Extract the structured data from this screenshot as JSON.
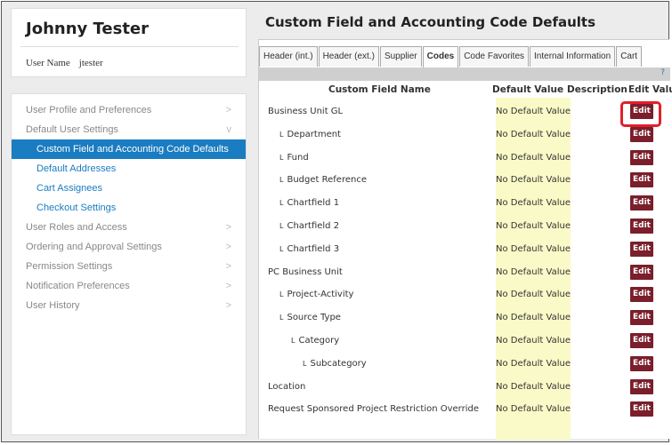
{
  "user": {
    "display_name": "Johnny Tester",
    "username_label": "User Name",
    "username_value": "jtester"
  },
  "nav": {
    "items": [
      {
        "label": "User Profile and Preferences",
        "chevron": ">"
      },
      {
        "label": "Default User Settings",
        "chevron": "v"
      },
      {
        "label": "Custom Field and Accounting Code Defaults"
      },
      {
        "label": "Default Addresses"
      },
      {
        "label": "Cart Assignees"
      },
      {
        "label": "Checkout Settings"
      },
      {
        "label": "User Roles and Access",
        "chevron": ">"
      },
      {
        "label": "Ordering and Approval Settings",
        "chevron": ">"
      },
      {
        "label": "Permission Settings",
        "chevron": ">"
      },
      {
        "label": "Notification Preferences",
        "chevron": ">"
      },
      {
        "label": "User History",
        "chevron": ">"
      }
    ]
  },
  "page": {
    "title": "Custom Field and Accounting Code Defaults",
    "help": "?"
  },
  "tabs": [
    "Header (int.)",
    "Header (ext.)",
    "Supplier",
    "Codes",
    "Code Favorites",
    "Internal Information",
    "Cart"
  ],
  "table": {
    "headers": {
      "name": "Custom Field Name",
      "default": "Default Value",
      "description": "Description",
      "edit": "Edit Values"
    },
    "rows": [
      {
        "name": "Business Unit GL",
        "value": "No Default Value",
        "edit": "Edit"
      },
      {
        "name": "Department",
        "prefix": "L",
        "value": "No Default Value",
        "edit": "Edit"
      },
      {
        "name": "Fund",
        "prefix": "L",
        "value": "No Default Value",
        "edit": "Edit"
      },
      {
        "name": "Budget Reference",
        "prefix": "L",
        "value": "No Default Value",
        "edit": "Edit"
      },
      {
        "name": "Chartfield 1",
        "prefix": "L",
        "value": "No Default Value",
        "edit": "Edit"
      },
      {
        "name": "Chartfield 2",
        "prefix": "L",
        "value": "No Default Value",
        "edit": "Edit"
      },
      {
        "name": "Chartfield 3",
        "prefix": "L",
        "value": "No Default Value",
        "edit": "Edit"
      },
      {
        "name": "PC Business Unit",
        "value": "No Default Value",
        "edit": "Edit"
      },
      {
        "name": "Project-Activity",
        "prefix": "L",
        "value": "No Default Value",
        "edit": "Edit"
      },
      {
        "name": "Source Type",
        "prefix": "L",
        "value": "No Default Value",
        "edit": "Edit"
      },
      {
        "name": "Category",
        "prefix": "L",
        "value": "No Default Value",
        "edit": "Edit"
      },
      {
        "name": "Subcategory",
        "prefix": "L",
        "value": "No Default Value",
        "edit": "Edit"
      },
      {
        "name": "Location",
        "value": "No Default Value",
        "edit": "Edit"
      },
      {
        "name": "Request Sponsored Project Restriction Override",
        "value": "No Default Value",
        "edit": "Edit"
      }
    ]
  },
  "colors": {
    "accent": "#1a7cc1",
    "edit_button": "#7a1f2b",
    "default_column": "#fafac8",
    "highlight": "#e0202a"
  }
}
